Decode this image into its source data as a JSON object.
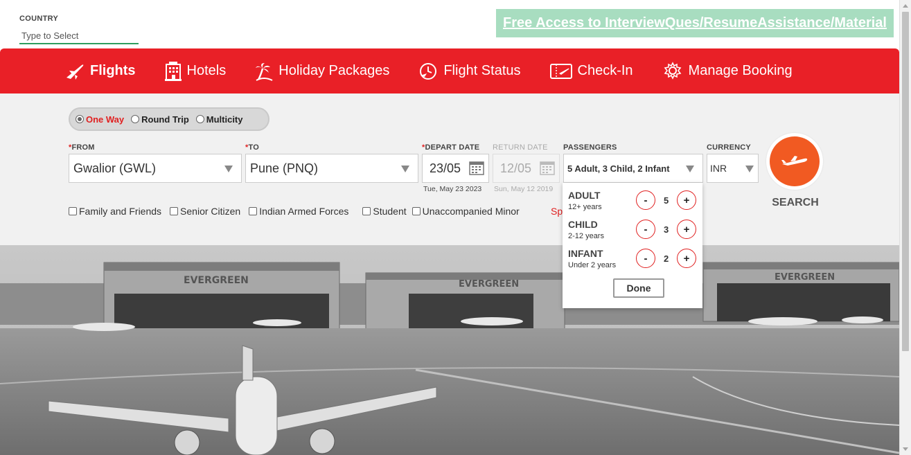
{
  "country": {
    "label": "COUNTRY",
    "placeholder": "Type to Select"
  },
  "promo": {
    "text": "Free Access to InterviewQues/ResumeAssistance/Material"
  },
  "nav": [
    {
      "label": "Flights",
      "icon": "airplane-icon",
      "active": true
    },
    {
      "label": "Hotels",
      "icon": "hotel-icon"
    },
    {
      "label": "Holiday Packages",
      "icon": "palm-tree-icon"
    },
    {
      "label": "Flight Status",
      "icon": "clock-icon"
    },
    {
      "label": "Check-In",
      "icon": "ticket-icon"
    },
    {
      "label": "Manage Booking",
      "icon": "gear-icon"
    }
  ],
  "trip_types": [
    {
      "label": "One Way",
      "selected": true
    },
    {
      "label": "Round Trip",
      "selected": false
    },
    {
      "label": "Multicity",
      "selected": false
    }
  ],
  "form": {
    "from_label": "FROM",
    "from_value": "Gwalior (GWL)",
    "to_label": "TO",
    "to_value": "Pune (PNQ)",
    "depart_label": "DEPART DATE",
    "depart_value": "23/05",
    "depart_sub": "Tue, May 23 2023",
    "return_label": "RETURN DATE",
    "return_value": "12/05",
    "return_sub": "Sun, May 12 2019",
    "passengers_label": "PASSENGERS",
    "passengers_value": "5 Adult, 3 Child, 2 Infant",
    "currency_label": "CURRENCY",
    "currency_value": "INR",
    "required_mark": "*"
  },
  "checkboxes": [
    "Family and Friends",
    "Senior Citizen",
    "Indian Armed Forces",
    "Student",
    "Unaccompanied Minor"
  ],
  "special_partial": "Sp",
  "search_label": "SEARCH",
  "passenger_popup": {
    "rows": [
      {
        "title": "ADULT",
        "sub": "12+ years",
        "count": "5"
      },
      {
        "title": "CHILD",
        "sub": "2-12 years",
        "count": "3"
      },
      {
        "title": "INFANT",
        "sub": "Under 2 years",
        "count": "2"
      }
    ],
    "minus": "-",
    "plus": "+",
    "done": "Done"
  },
  "hero": {
    "signs": [
      "EVERGREEN",
      "EVERGREEN",
      "EVERGREEN"
    ]
  },
  "colors": {
    "brand_red": "#e92027",
    "search_orange": "#f15a22",
    "promo_green": "#a8ddc0",
    "accent_green": "#2e9e5e"
  }
}
